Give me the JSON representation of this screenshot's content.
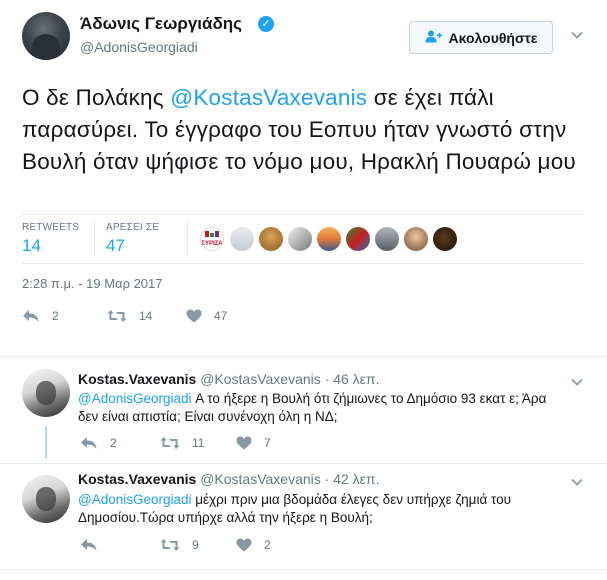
{
  "tweet": {
    "author_name": "Άδωνις Γεωργιάδης",
    "handle": "@AdonisGeorgiadi",
    "follow_label": "Ακολουθήστε",
    "text_before": "Ο δε Πολάκης ",
    "mention": "@KostasVaxevanis",
    "text_after": " σε έχει πάλι παρασύρει. Το έγγραφο του Εοπυυ ήταν γνωστό στην Βουλή όταν ψήφισε το νόμο μου, Ηρακλή Πουαρώ μου",
    "retweets_label": "RETWEETS",
    "retweets": "14",
    "likes_label": "ΑΡΕΣΕΙ ΣΕ",
    "likes": "47",
    "liker_badge_text": "ΣΥΡΙΖΑ",
    "timestamp": "2:28 π.μ. - 19 Μαρ 2017",
    "actions": {
      "replies": "2",
      "retweets": "14",
      "likes": "47"
    },
    "colors": {
      "accent": "#1da1f2",
      "muted": "#657786",
      "syriza_red": "#d0102a"
    }
  },
  "replies": [
    {
      "name": "Kostas.Vaxevanis",
      "handle": "@KostasVaxevanis",
      "time": "46 λεπ.",
      "mention": "@AdonisGeorgiadi",
      "text": " Α το ήξερε η Βουλή ότι ζήμιωνες το Δημόσιο 93 εκατ ε; Άρα δεν είναι απιστία; Είναι συνένοχη όλη η ΝΔ;",
      "actions": {
        "replies": "2",
        "retweets": "11",
        "likes": "7"
      }
    },
    {
      "name": "Kostas.Vaxevanis",
      "handle": "@KostasVaxevanis",
      "time": "42 λεπ.",
      "mention": "@AdonisGeorgiadi",
      "text": " μέχρι πριν μια βδομάδα έλεγες δεν υπήρχε ζημιά του Δημοσίου.Τώρα υπήρχε αλλά την ήξερε η Βουλή;",
      "actions": {
        "replies": "",
        "retweets": "9",
        "likes": "2"
      }
    }
  ],
  "icons": {
    "verified": "verified-badge-icon",
    "follow": "add-user-icon",
    "caret": "chevron-down-icon",
    "reply": "reply-arrow-icon",
    "retweet": "retweet-icon",
    "like": "heart-icon"
  }
}
